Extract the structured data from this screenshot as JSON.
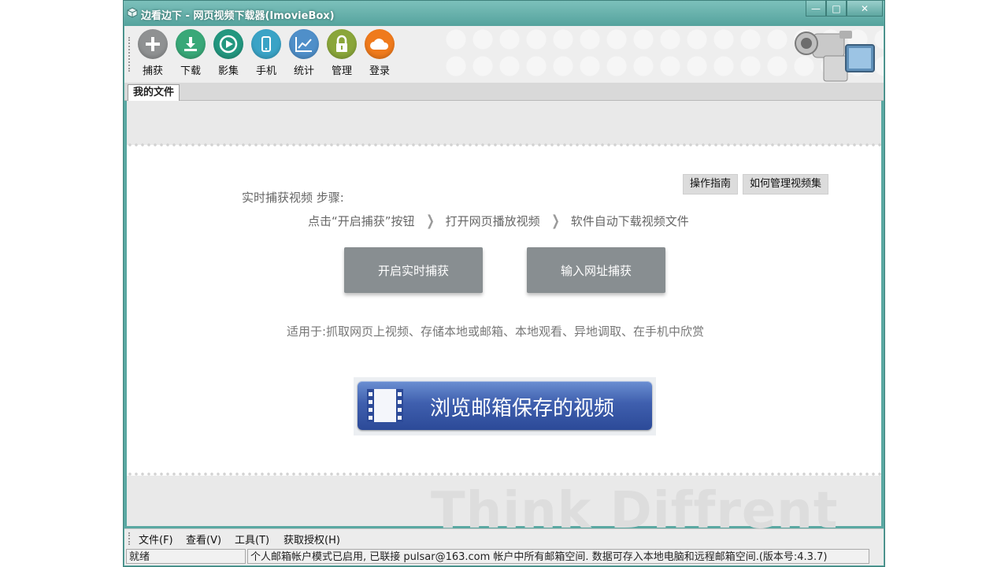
{
  "window": {
    "title": "边看边下 - 网页视频下载器(ImovieBox)",
    "buttons": {
      "minimize": "—",
      "maximize": "□",
      "close": "✕"
    }
  },
  "toolbar": {
    "items": [
      {
        "label": "捕获",
        "icon": "plus-icon",
        "color": "#8f9192"
      },
      {
        "label": "下载",
        "icon": "download-icon",
        "color": "#39a878"
      },
      {
        "label": "影集",
        "icon": "play-icon",
        "color": "#23977f"
      },
      {
        "label": "手机",
        "icon": "phone-icon",
        "color": "#3aa3c6"
      },
      {
        "label": "统计",
        "icon": "chart-icon",
        "color": "#4f8fc9"
      },
      {
        "label": "管理",
        "icon": "lock-icon",
        "color": "#8aa63a"
      },
      {
        "label": "登录",
        "icon": "cloud-icon",
        "color": "#ef7a1c"
      }
    ]
  },
  "tabs": [
    {
      "label": "我的文件"
    }
  ],
  "main": {
    "guide_button": "操作指南",
    "manage_button": "如何管理视频集",
    "steps_title": "实时捕获视频 步骤:",
    "steps": [
      "点击“开启捕获”按钮",
      "打开网页播放视频",
      "软件自动下载视频文件"
    ],
    "start_capture_button": "开启实时捕获",
    "url_capture_button": "输入网址捕获",
    "usage": "适用于:抓取网页上视频、存储本地或邮箱、本地观看、异地调取、在手机中欣赏",
    "mailbox_button": "浏览邮箱保存的视频",
    "watermark": "Think Diffrent"
  },
  "menubar": {
    "items": [
      "文件(F)",
      "查看(V)",
      "工具(T)",
      "获取授权(H)"
    ]
  },
  "statusbar": {
    "state": "就绪",
    "message": "个人邮箱帐户模式已启用, 已联接 pulsar@163.com 帐户中所有邮箱空间. 数据可存入本地电脑和远程邮箱空间.(版本号:4.3.7)"
  }
}
